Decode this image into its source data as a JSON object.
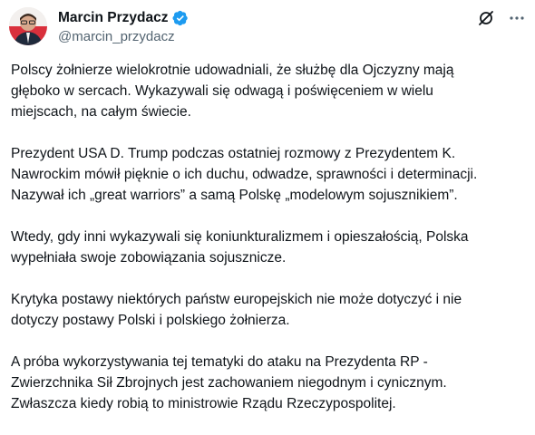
{
  "author": {
    "display_name": "Marcin Przydacz",
    "handle": "@marcin_przydacz",
    "verified": true
  },
  "icons": {
    "verified": "verified-badge-icon",
    "grok": "grok-icon",
    "more": "more-options-icon"
  },
  "colors": {
    "verified": "#1d9bf0",
    "secondary_text": "#536471",
    "primary_text": "#0f1419"
  },
  "tweet": {
    "paragraphs": [
      "Polscy żołnierze wielokrotnie udowadniali, że służbę dla Ojczyzny mają\ngłęboko w sercach. Wykazywali się odwagą i poświęceniem w wielu\nmiejscach, na całym świecie.",
      "Prezydent USA D. Trump podczas ostatniej rozmowy z Prezydentem K.\nNawrockim mówił pięknie o ich duchu, odwadze, sprawności i determinacji.\nNazywał ich „great warriors” a samą Polskę „modelowym sojusznikiem”.",
      "Wtedy, gdy inni wykazywali się koniunkturalizmem i opieszałością, Polska\nwypełniała swoje zobowiązania sojusznicze.",
      "Krytyka postawy niektórych państw europejskich nie może dotyczyć i nie\ndotyczy postawy Polski i polskiego żołnierza.",
      "A próba wykorzystywania tej tematyki do ataku na Prezydenta RP -\nZwierzchnika Sił Zbrojnych jest zachowaniem niegodnym i cynicznym.\nZwłaszcza kiedy robią to ministrowie Rządu Rzeczypospolitej."
    ]
  }
}
